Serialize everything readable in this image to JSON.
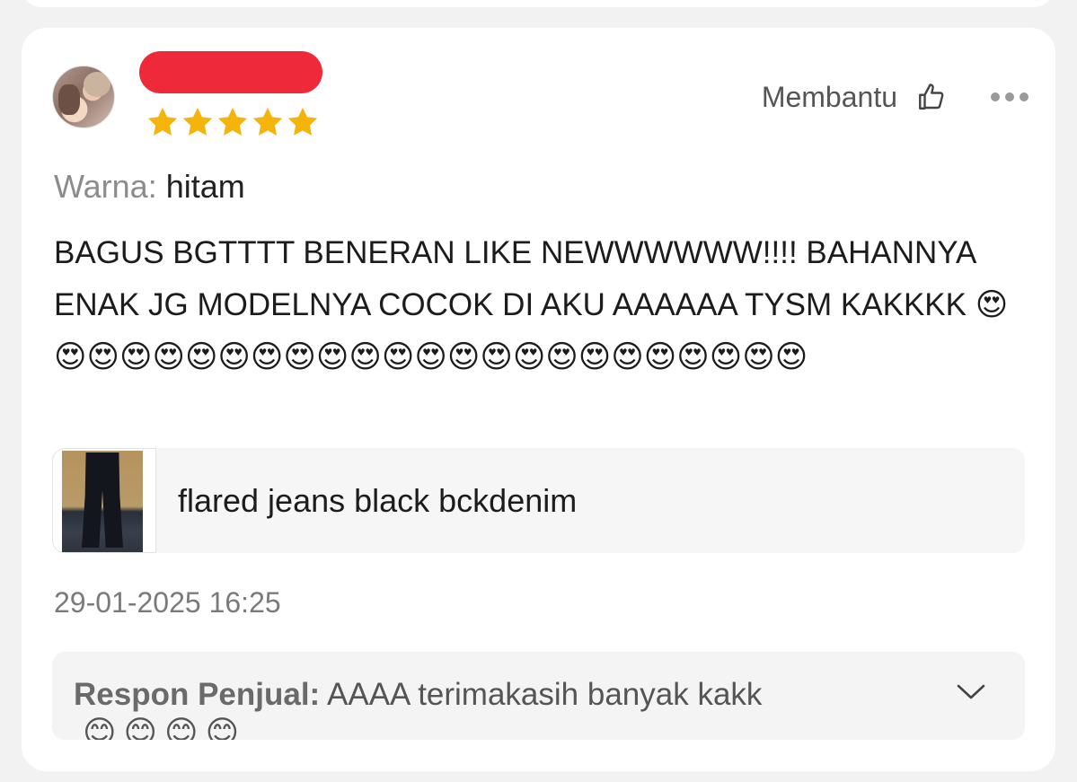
{
  "review": {
    "rating": 5,
    "helpful_label": "Membantu",
    "variant_label": "Warna:",
    "variant_value": "hitam",
    "text": "BAGUS BGTTTT BENERAN LIKE NEWWWWWW!!!! BAHANNYA ENAK JG MODELNYA COCOK DI AKU AAAAAA TYSM KAKKKK 😍😍😍😍😍😍😍😍😍😍😍😍😍😍😍😍😍😍😍😍😍😍😍😍",
    "product_name": "flared jeans black bckdenim",
    "date": "29-01-2025 16:25"
  },
  "seller_response": {
    "label": "Respon Penjual:",
    "text": "AAAA terimakasih banyak kakk",
    "emoji_partial": "😊😊😊😊"
  },
  "icons": {
    "star": "star-icon",
    "thumbs_up": "thumbs-up-icon",
    "more": "more-icon",
    "chevron": "chevron-down-icon"
  },
  "colors": {
    "star": "#F5B40A",
    "redaction": "#EE2A3A",
    "muted_text": "#8C8C8C"
  }
}
